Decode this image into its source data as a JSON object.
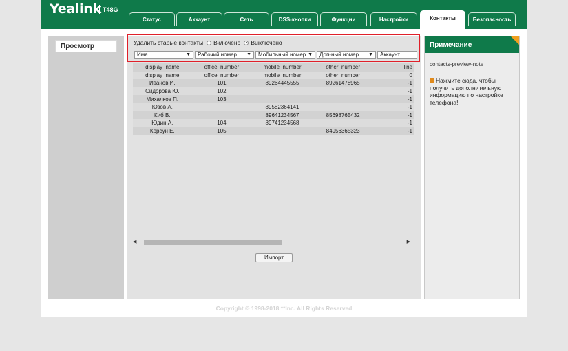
{
  "brand": {
    "name": "Yealink",
    "model": "T48G"
  },
  "tabs": [
    "Статус",
    "Аккаунт",
    "Сеть",
    "DSS-кнопки",
    "Функции",
    "Настройки",
    "Контакты",
    "Безопасность"
  ],
  "active_tab": "Контакты",
  "sidebar": {
    "items": [
      "Просмотр"
    ]
  },
  "delete_old": {
    "label": "Удалить старые контакты",
    "option_on": "Включено",
    "option_off": "Выключено",
    "selected": "Выключено"
  },
  "columns": [
    "Имя",
    "Рабочий номер",
    "Мобильный номер",
    "Доп-ный номер",
    "Аккаунт"
  ],
  "rows": [
    [
      "display_name",
      "office_number",
      "mobile_number",
      "other_number",
      "line"
    ],
    [
      "display_name",
      "office_number",
      "mobile_number",
      "other_number",
      "0"
    ],
    [
      "Иванов И.",
      "101",
      "89264445555",
      "89261478965",
      "-1"
    ],
    [
      "Сидорова Ю.",
      "102",
      "",
      "",
      "-1"
    ],
    [
      "Михалков П.",
      "103",
      "",
      "",
      "-1"
    ],
    [
      "Юзов А.",
      "",
      "89582364141",
      "",
      "-1"
    ],
    [
      "Киб В.",
      "",
      "89641234567",
      "85698765432",
      "-1"
    ],
    [
      "Юдин А.",
      "104",
      "89741234568",
      "",
      "-1"
    ],
    [
      "Корсун Е.",
      "105",
      "",
      "84956365323",
      "-1"
    ]
  ],
  "import_button": "Импорт",
  "note": {
    "title": "Примечание",
    "key": "contacts-preview-note",
    "link_text": "Нажмите сюда, чтобы получить дополнительную информацию по настройке телефона!"
  },
  "copyright": "Copyright © 1998-2018 **Inc. All Rights Reserved",
  "colors": {
    "brand_green": "#0f7a4a",
    "highlight_red": "#e0202a",
    "note_accent": "#f0a020"
  }
}
